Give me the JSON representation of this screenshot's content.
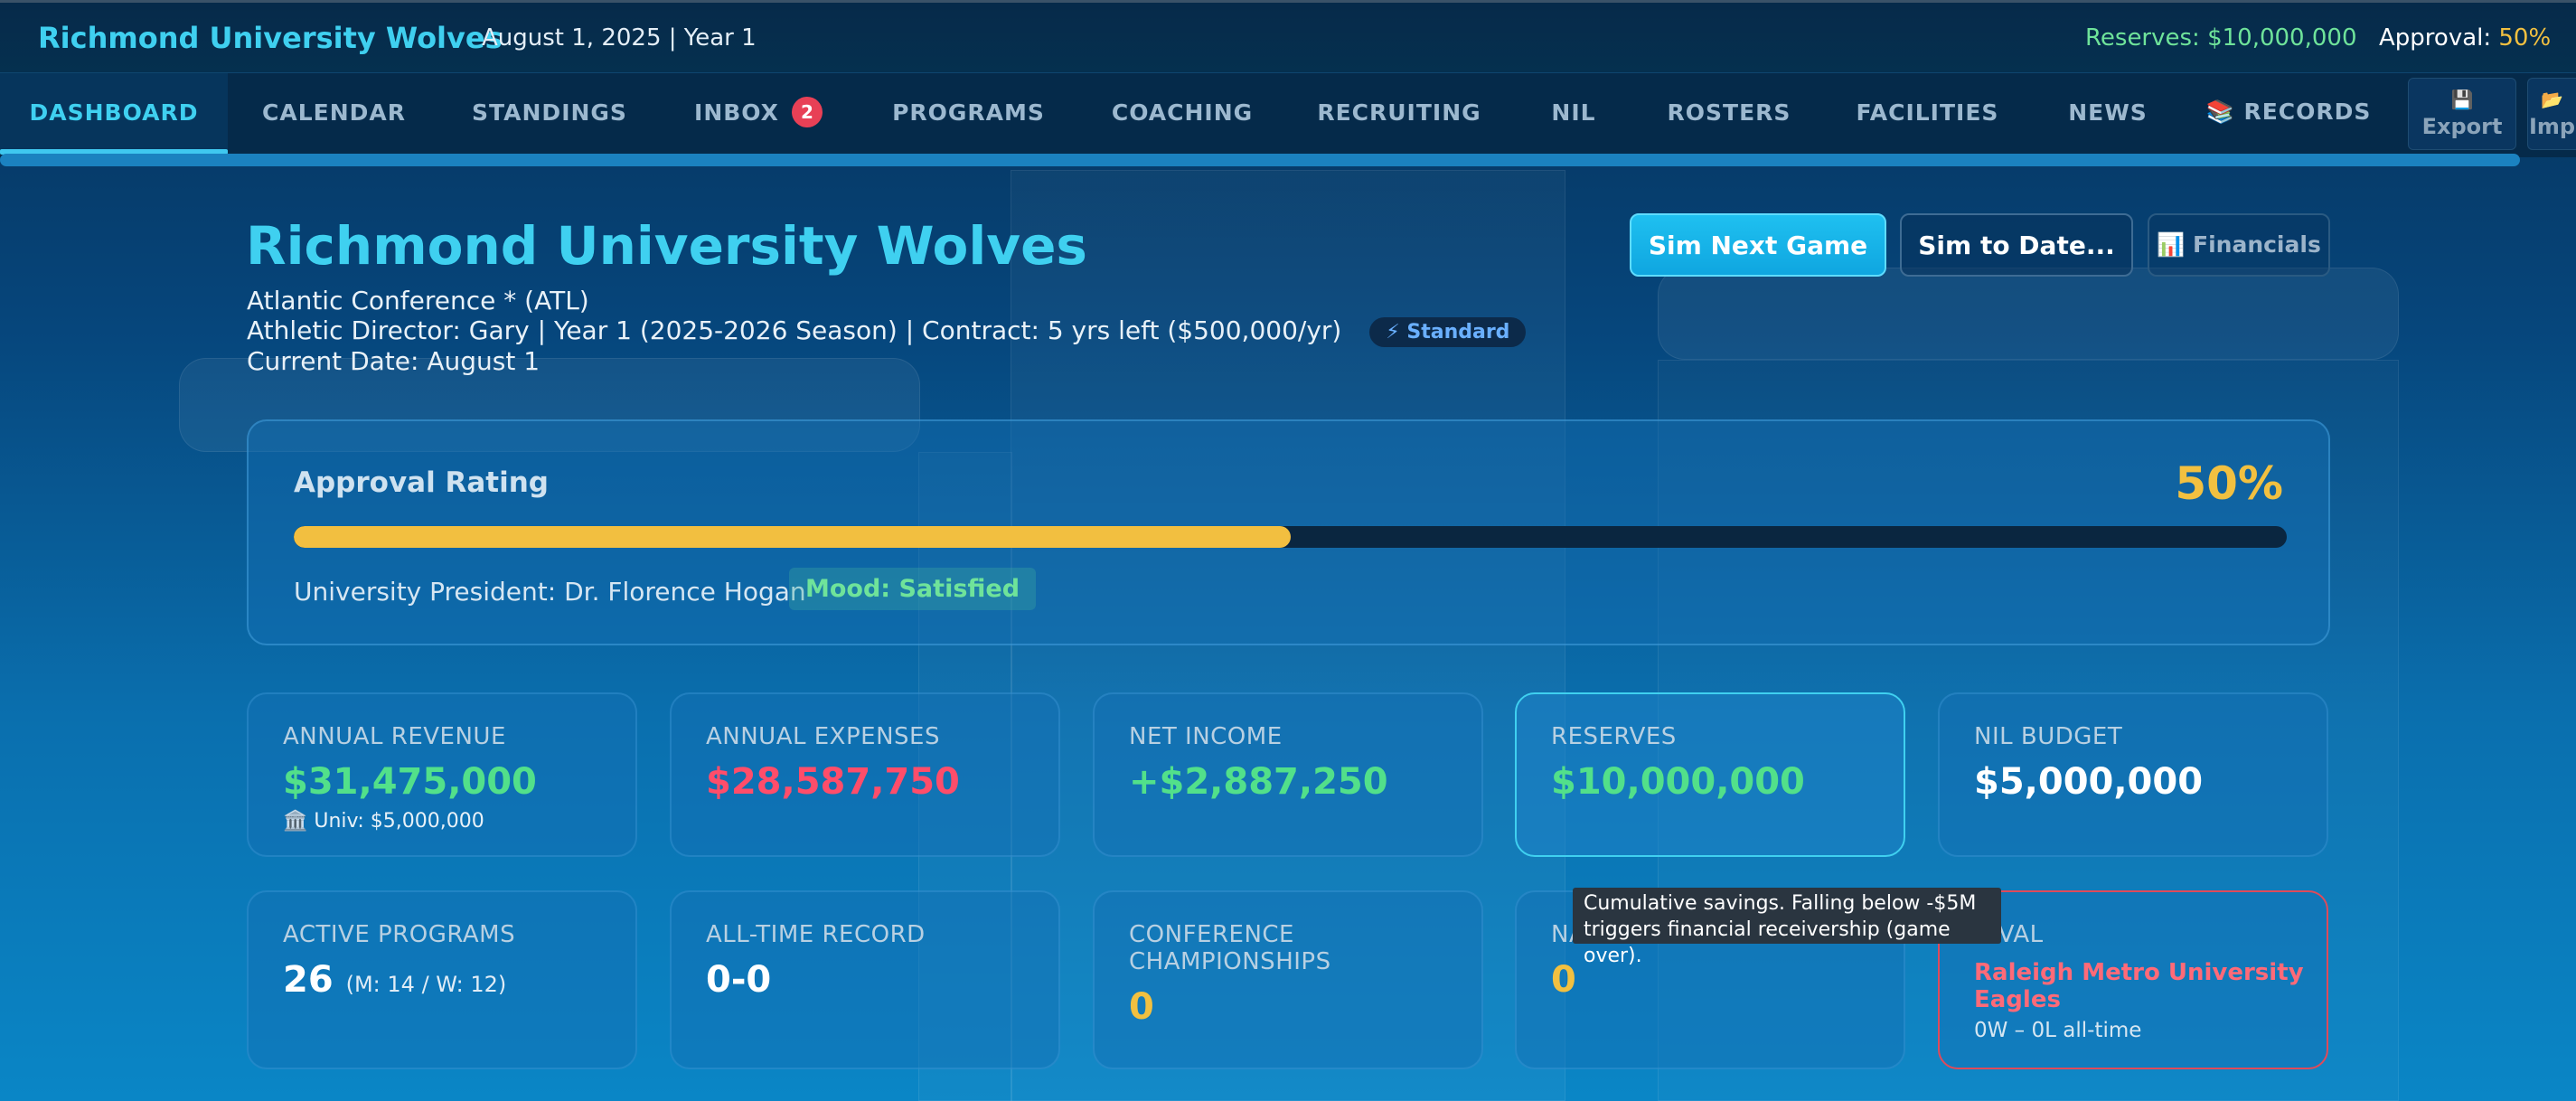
{
  "topbar": {
    "team_name": "Richmond University Wolves",
    "date": "August 1, 2025 | Year 1",
    "reserves": "Reserves: $10,000,000",
    "approval_label": "Approval: ",
    "approval_value": "50%"
  },
  "nav": {
    "items": [
      {
        "label": "DASHBOARD",
        "active": true
      },
      {
        "label": "CALENDAR"
      },
      {
        "label": "STANDINGS"
      },
      {
        "label": "INBOX",
        "badge": "2"
      },
      {
        "label": "PROGRAMS"
      },
      {
        "label": "COACHING"
      },
      {
        "label": "RECRUITING"
      },
      {
        "label": "NIL"
      },
      {
        "label": "ROSTERS"
      },
      {
        "label": "FACILITIES"
      },
      {
        "label": "NEWS"
      },
      {
        "label": "📚 RECORDS"
      }
    ],
    "export_label": "Export",
    "import_label": "Imp"
  },
  "header": {
    "title": "Richmond University Wolves",
    "conference": "Atlantic Conference * (ATL)",
    "director_line": "Athletic Director: Gary | Year 1 (2025-2026 Season) | Contract: 5 yrs left ($500,000/yr)",
    "difficulty_badge": "⚡ Standard",
    "current_date": "Current Date: August 1",
    "sim_next": "Sim Next Game",
    "sim_to_date": "Sim to Date...",
    "financials": "📊 Financials"
  },
  "approval": {
    "label": "Approval Rating",
    "percent": "50%",
    "fill_fraction": 0.5,
    "president": "University President: Dr. Florence Hogan",
    "mood": "Mood: Satisfied"
  },
  "stats": {
    "revenue": {
      "title": "ANNUAL REVENUE",
      "value": "$31,475,000",
      "sub": "🏛️ Univ: $5,000,000"
    },
    "expenses": {
      "title": "ANNUAL EXPENSES",
      "value": "$28,587,750"
    },
    "net_income": {
      "title": "NET INCOME",
      "value": "+$2,887,250"
    },
    "reserves": {
      "title": "RESERVES",
      "value": "$10,000,000"
    },
    "nil_budget": {
      "title": "NIL BUDGET",
      "value": "$5,000,000"
    },
    "programs": {
      "title": "ACTIVE PROGRAMS",
      "value": "26",
      "sub": "(M: 14 / W: 12)"
    },
    "record": {
      "title": "ALL-TIME RECORD",
      "value": "0-0"
    },
    "conf_champs": {
      "title_line1": "CONFERENCE",
      "title_line2": "CHAMPIONSHIPS",
      "value": "0"
    },
    "nat": {
      "title": "NA",
      "value": "0"
    },
    "rival": {
      "title": "RIVAL",
      "name_line1": "Raleigh Metro University",
      "name_line2": "Eagles",
      "record": "0W – 0L all-time"
    }
  },
  "tooltip": {
    "line1": "Cumulative savings. Falling below -$5M",
    "line2": "triggers financial receivership (game over)."
  },
  "colors": {
    "accent": "#3fd0f0",
    "positive": "#52e08a",
    "negative": "#ff4d6a",
    "gold": "#f2c040",
    "rival_border": "#e04a5a"
  }
}
